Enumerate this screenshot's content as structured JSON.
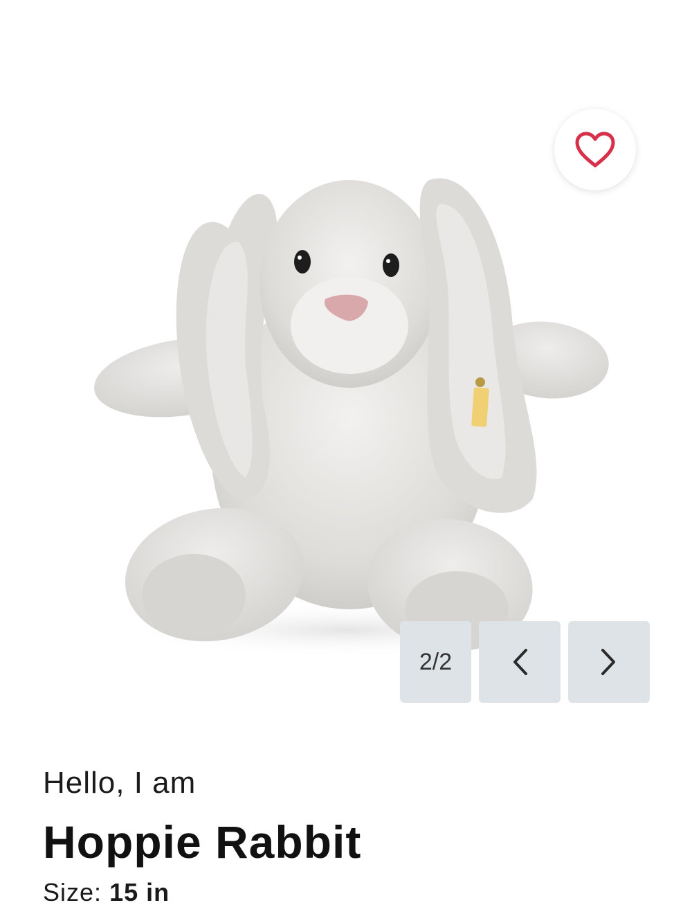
{
  "gallery": {
    "image_alt": "Plush light grey bunny rabbit with floppy ears",
    "counter": "2/2",
    "favorite_icon": "heart-outline-icon",
    "favorite_color": "#d6304a",
    "prev_icon": "chevron-left-icon",
    "next_icon": "chevron-right-icon"
  },
  "product": {
    "greeting": "Hello, I am",
    "name": "Hoppie Rabbit",
    "size_label": "Size:",
    "size_value": "15 in"
  }
}
